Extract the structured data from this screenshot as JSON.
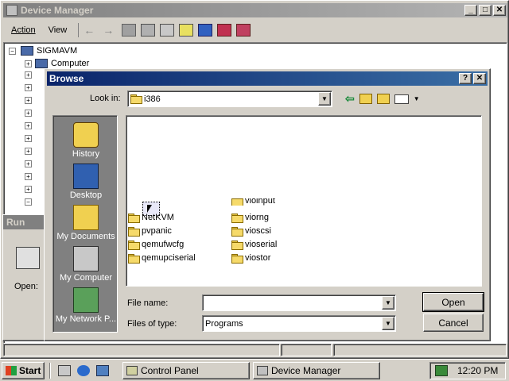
{
  "device_manager": {
    "title": "Device Manager",
    "menu": [
      "Action",
      "View"
    ],
    "tree_root": "SIGMAVM",
    "tree_first_child": "Computer"
  },
  "run_dialog": {
    "title": "Run",
    "open_label": "Open:"
  },
  "browse": {
    "title": "Browse",
    "look_in_label": "Look in:",
    "look_in_value": "i386",
    "places": [
      "History",
      "Desktop",
      "My Documents",
      "My Computer",
      "My Network P..."
    ],
    "files_col1": [
      "NetKVM",
      "pvpanic",
      "qemufwcfg",
      "qemupciserial"
    ],
    "files_col2": [
      "vioinput",
      "viorng",
      "vioscsi",
      "vioserial",
      "viostor"
    ],
    "file_name_label": "File name:",
    "file_name_value": "",
    "files_of_type_label": "Files of type:",
    "files_of_type_value": "Programs",
    "open_button": "Open",
    "cancel_button": "Cancel"
  },
  "taskbar": {
    "start": "Start",
    "tasks": [
      "Control Panel",
      "Device Manager"
    ],
    "clock": "12:20 PM"
  },
  "colors": {
    "active_title": "#0a246a",
    "inactive_title": "#808080",
    "face": "#d4d0c8",
    "places_bar": "#808080"
  }
}
